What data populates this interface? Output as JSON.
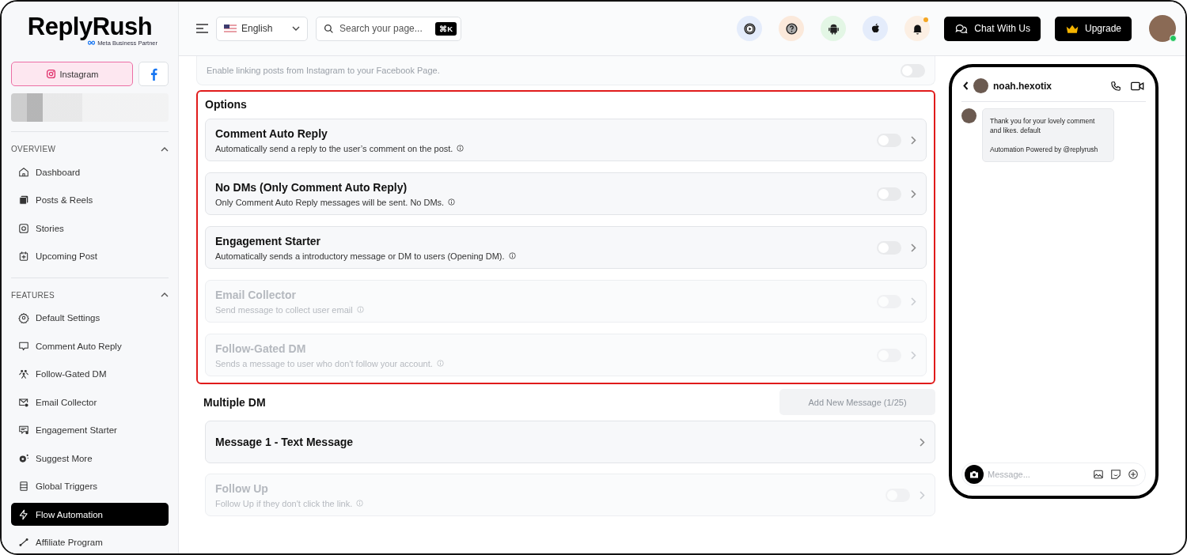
{
  "sidebar": {
    "logo": {
      "name": "ReplyRush",
      "tagline": "Meta Business Partner"
    },
    "platforms": [
      {
        "kind": "instagram",
        "label": "Instagram",
        "selected": true
      },
      {
        "kind": "facebook",
        "selected": false
      }
    ],
    "sections": [
      {
        "title": "OVERVIEW",
        "expanded": true,
        "items": [
          {
            "kind": "home",
            "label": "Dashboard",
            "selected": false
          },
          {
            "kind": "posts",
            "label": "Posts & Reels",
            "selected": false
          },
          {
            "kind": "stories",
            "label": "Stories",
            "selected": false
          },
          {
            "kind": "calendar",
            "label": "Upcoming Post",
            "selected": false
          }
        ]
      },
      {
        "title": "FEATURES",
        "expanded": true,
        "items": [
          {
            "kind": "gear",
            "label": "Default Settings",
            "selected": false
          },
          {
            "kind": "comment",
            "label": "Comment Auto Reply",
            "selected": false
          },
          {
            "kind": "people",
            "label": "Follow-Gated DM",
            "selected": false
          },
          {
            "kind": "mail",
            "label": "Email Collector",
            "selected": false
          },
          {
            "kind": "chat",
            "label": "Engagement Starter",
            "selected": false
          },
          {
            "kind": "sparkle",
            "label": "Suggest More",
            "selected": false
          },
          {
            "kind": "list",
            "label": "Global Triggers",
            "selected": false
          },
          {
            "kind": "bolt",
            "label": "Flow Automation",
            "selected": true
          },
          {
            "kind": "share",
            "label": "Affiliate Program",
            "selected": false
          }
        ]
      }
    ]
  },
  "header": {
    "language": "English",
    "search": {
      "placeholder": "Search your page...",
      "shortcut": "⌘K"
    },
    "icon_buttons": [
      {
        "kind": "video"
      },
      {
        "kind": "help"
      },
      {
        "kind": "android"
      },
      {
        "kind": "apple"
      },
      {
        "kind": "bell",
        "badge": true
      }
    ],
    "buttons": [
      {
        "kind": "chat",
        "label": "Chat With Us"
      },
      {
        "kind": "crown",
        "label": "Upgrade"
      }
    ],
    "user": {
      "online": true
    }
  },
  "top_card": {
    "description": "Enable linking posts from Instagram to your Facebook Page.",
    "on": false
  },
  "options": {
    "title": "Options",
    "highlighted": true,
    "items": [
      {
        "title": "Comment Auto Reply",
        "description": "Automatically send a reply to the user’s comment on the post.",
        "on": false,
        "disabled": false
      },
      {
        "title": "No DMs (Only Comment Auto Reply)",
        "description": "Only Comment Auto Reply messages will be sent. No DMs.",
        "on": false,
        "disabled": false
      },
      {
        "title": "Engagement Starter",
        "description": "Automatically sends a introductory message or DM to users (Opening DM).",
        "on": false,
        "disabled": false
      },
      {
        "title": "Email Collector",
        "description": "Send message to collect user email",
        "on": false,
        "disabled": true
      },
      {
        "title": "Follow-Gated DM",
        "description": "Sends a message to user who don't follow your account.",
        "on": false,
        "disabled": true
      }
    ]
  },
  "multiple_dm": {
    "title": "Multiple DM",
    "add_button": {
      "label": "Add New Message (1/25)",
      "disabled": true
    },
    "messages": [
      {
        "kind": "link",
        "title": "Message 1 - Text Message",
        "disabled": false
      },
      {
        "kind": "toggle",
        "title": "Follow Up",
        "description": "Follow Up if they don't click the link.",
        "on": false,
        "disabled": true
      }
    ]
  },
  "preview": {
    "username": "noah.hexotix",
    "messages": [
      {
        "paragraphs": [
          "Thank you for your lovely comment and likes. default",
          "Automation Powered by @replyrush"
        ]
      }
    ],
    "input_placeholder": "Message..."
  }
}
